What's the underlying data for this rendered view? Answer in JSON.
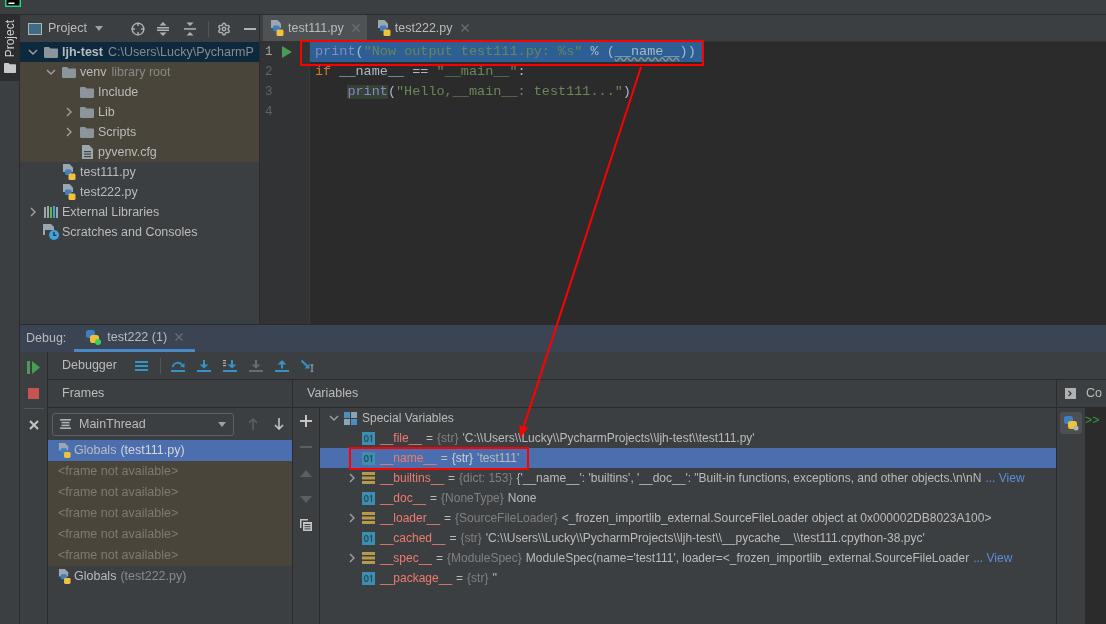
{
  "tool_strip": {
    "tabs": [
      {
        "label": "Project",
        "selected": true
      }
    ]
  },
  "project_panel": {
    "title": "Project",
    "tree": [
      {
        "kind": "project",
        "label": "ljh-test",
        "detail": "C:\\Users\\Lucky\\PycharmP",
        "expanded": true,
        "selected": true,
        "tinted": false,
        "children": [
          {
            "kind": "folder",
            "label": "venv",
            "detail": "library root",
            "expanded": true,
            "selected": false,
            "tinted": true,
            "children": [
              {
                "kind": "folder",
                "label": "Include",
                "selected": false,
                "tinted": true
              },
              {
                "kind": "folder",
                "label": "Lib",
                "expanded": false,
                "selected": false,
                "tinted": true
              },
              {
                "kind": "folder",
                "label": "Scripts",
                "expanded": false,
                "selected": false,
                "tinted": true
              },
              {
                "kind": "text",
                "label": "pyvenv.cfg",
                "selected": false,
                "tinted": true
              }
            ]
          },
          {
            "kind": "python",
            "label": "test111.py",
            "selected": false,
            "tinted": false
          },
          {
            "kind": "python",
            "label": "test222.py",
            "selected": false,
            "tinted": false
          }
        ]
      },
      {
        "kind": "libraries",
        "label": "External Libraries",
        "expanded": false,
        "selected": false,
        "tinted": false
      },
      {
        "kind": "scratches",
        "label": "Scratches and Consoles",
        "selected": false,
        "tinted": false
      }
    ]
  },
  "editor": {
    "tabs": [
      {
        "label": "test111.py",
        "selected": true
      },
      {
        "label": "test222.py",
        "selected": false
      }
    ],
    "lines": [
      {
        "number": "1",
        "current": true,
        "run_marker": true,
        "boxed": true,
        "tokens": [
          {
            "kind": "builtin",
            "text": "print"
          },
          {
            "kind": "plain",
            "text": "("
          },
          {
            "kind": "string",
            "text": "\"Now output test111.py: %s\""
          },
          {
            "kind": "plain",
            "text": " % ("
          },
          {
            "kind": "warning",
            "text": "__name__"
          },
          {
            "kind": "plain",
            "text": "))"
          }
        ]
      },
      {
        "number": "2",
        "current": false,
        "run_marker": false,
        "boxed": false,
        "tokens": [
          {
            "kind": "keyword",
            "text": "if"
          },
          {
            "kind": "plain",
            "text": " __name__ == "
          },
          {
            "kind": "string",
            "text": "\"__main__\""
          },
          {
            "kind": "plain",
            "text": ":"
          }
        ],
        "children": [
          {
            "number": "3",
            "current": false,
            "run_marker": false,
            "boxed": false,
            "tokens": [
              {
                "kind": "usage",
                "text": "print"
              },
              {
                "kind": "plain",
                "text": "("
              },
              {
                "kind": "string",
                "text": "\"Hello,__main__: test111...\""
              },
              {
                "kind": "plain",
                "text": ")"
              }
            ]
          }
        ]
      },
      {
        "number": "4",
        "current": false,
        "run_marker": false,
        "boxed": false
      }
    ]
  },
  "debug_panel": {
    "label": "Debug:",
    "tabs": [
      {
        "label": "test222 (1)",
        "selected": true
      }
    ],
    "toolbar": {
      "tab": "Debugger",
      "buttons": [
        {
          "kind": "layout",
          "disabled": false
        },
        {
          "kind": "over",
          "disabled": false
        },
        {
          "kind": "into",
          "disabled": false
        },
        {
          "kind": "mycode",
          "disabled": false
        },
        {
          "kind": "force",
          "disabled": true
        },
        {
          "kind": "out",
          "disabled": false
        },
        {
          "kind": "cursor",
          "disabled": false
        }
      ]
    },
    "frames": {
      "title": "Frames",
      "thread": "MainThread",
      "nav": [
        {
          "kind": "up",
          "disabled": true
        },
        {
          "kind": "down",
          "disabled": false
        }
      ],
      "items": [
        {
          "kind": "frame",
          "label": "Globals",
          "detail": "(test111.py)",
          "selected": true,
          "tinted": false
        },
        {
          "kind": "placeholder",
          "label": "<frame not available>",
          "selected": false,
          "tinted": true
        },
        {
          "kind": "placeholder",
          "label": "<frame not available>",
          "selected": false,
          "tinted": true
        },
        {
          "kind": "placeholder",
          "label": "<frame not available>",
          "selected": false,
          "tinted": true
        },
        {
          "kind": "placeholder",
          "label": "<frame not available>",
          "selected": false,
          "tinted": true
        },
        {
          "kind": "placeholder",
          "label": "<frame not available>",
          "selected": false,
          "tinted": true
        },
        {
          "kind": "frame",
          "label": "Globals",
          "detail": "(test222.py)",
          "selected": false,
          "tinted": false
        }
      ]
    },
    "variables": {
      "title": "Variables",
      "tools": [
        {
          "kind": "add",
          "disabled": false
        },
        {
          "kind": "remove",
          "disabled": true
        },
        {
          "kind": "up",
          "disabled": true
        },
        {
          "kind": "down",
          "disabled": true
        },
        {
          "kind": "copy",
          "disabled": false
        }
      ],
      "tree": [
        {
          "kind": "group",
          "name": "Special Variables",
          "expanded": true,
          "selected": false,
          "boxed": false,
          "children": [
            {
              "kind": "scalar",
              "name": "__file__",
              "equals": "=",
              "type": "{str}",
              "value": "'C:\\\\Users\\\\Lucky\\\\PycharmProjects\\\\ljh-test\\\\test111.py'",
              "selected": false,
              "boxed": false
            },
            {
              "kind": "scalar",
              "name": "__name__",
              "equals": "=",
              "type": "{str}",
              "value": "'test111'",
              "selected": true,
              "boxed": true
            },
            {
              "kind": "object",
              "name": "__builtins__",
              "equals": "=",
              "type": "{dict: 153}",
              "value": "{'__name__': 'builtins', '__doc__': \"Built-in functions, exceptions, and other objects.\\n\\nN",
              "link": "... View",
              "expanded": false,
              "selected": false,
              "boxed": false
            },
            {
              "kind": "scalar",
              "name": "__doc__",
              "equals": "=",
              "type": "{NoneType}",
              "value": "None",
              "selected": false,
              "boxed": false
            },
            {
              "kind": "object",
              "name": "__loader__",
              "equals": "=",
              "type": "{SourceFileLoader}",
              "value": "<_frozen_importlib_external.SourceFileLoader object at 0x000002DB8023A100>",
              "expanded": false,
              "selected": false,
              "boxed": false
            },
            {
              "kind": "scalar",
              "name": "__cached__",
              "equals": "=",
              "type": "{str}",
              "value": "'C:\\\\Users\\\\Lucky\\\\PycharmProjects\\\\ljh-test\\\\__pycache__\\\\test111.cpython-38.pyc'",
              "selected": false,
              "boxed": false
            },
            {
              "kind": "object",
              "name": "__spec__",
              "equals": "=",
              "type": "{ModuleSpec}",
              "value": "ModuleSpec(name='test111', loader=<_frozen_importlib_external.SourceFileLoader",
              "link": "... View",
              "expanded": false,
              "selected": false,
              "boxed": false
            },
            {
              "kind": "scalar",
              "name": "__package__",
              "equals": "=",
              "type": "{str}",
              "value": "''",
              "selected": false,
              "boxed": false
            }
          ]
        }
      ]
    },
    "console": {
      "title": "Co",
      "prompt": ">>"
    }
  }
}
